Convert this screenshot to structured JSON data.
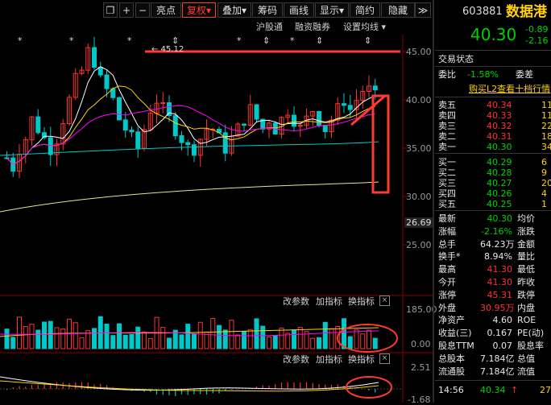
{
  "toolbar": {
    "icons": [
      "restore-icon",
      "plus-icon",
      "minus-icon"
    ],
    "buttons": [
      "亮点",
      "复权",
      "叠加",
      "筹码",
      "画线",
      "显示",
      "简约",
      "隐藏"
    ],
    "arrow_left": "◀",
    "arrow_right": "▶",
    "arrow_double": "≫"
  },
  "subbar": {
    "links": [
      "沪股通",
      "融资融券",
      "设置均线"
    ]
  },
  "kline": {
    "price_axis": [
      "45.00",
      "40.00",
      "35.00",
      "30.00",
      "25.00"
    ],
    "current_marker": "26.69",
    "high_label": "← 45.12",
    "star_marks": [
      "*",
      "*",
      "*",
      "*",
      "*",
      "*",
      "*",
      "*"
    ],
    "ma_colors": [
      "#ffffff",
      "#ffd200",
      "#ff00ff",
      "#00c8c8",
      "#e6e690"
    ],
    "up_color": "#ff3232",
    "down_color": "#00c8c8",
    "annotation_color": "#ff3b30"
  },
  "volume_panel": {
    "toolbar": [
      "改参数",
      "加指标",
      "换指标"
    ],
    "close": "×",
    "axis": [
      "185.00",
      "0.00"
    ]
  },
  "macd_panel": {
    "toolbar": [
      "改参数",
      "加指标",
      "换指标"
    ],
    "close": "×",
    "axis": [
      "2.51",
      "-1.68"
    ]
  },
  "quote": {
    "code": "603881",
    "name": "数据港",
    "price": "40.30",
    "change": "-0.89",
    "pct": "-2.16",
    "section_title": "交易状态",
    "weibi_label": "委比",
    "weibi_value": "-1.58%",
    "weicha_label": "委差",
    "l2_link": "购买L2查看十档行情",
    "asks": [
      {
        "label": "卖五",
        "price": "40.34",
        "vol": "11"
      },
      {
        "label": "卖四",
        "price": "40.33",
        "vol": "11"
      },
      {
        "label": "卖三",
        "price": "40.32",
        "vol": "22"
      },
      {
        "label": "卖二",
        "price": "40.31",
        "vol": "18"
      },
      {
        "label": "卖一",
        "price": "40.30",
        "vol": "34"
      }
    ],
    "bids": [
      {
        "label": "买一",
        "price": "40.29",
        "vol": "6"
      },
      {
        "label": "买二",
        "price": "40.28",
        "vol": "9"
      },
      {
        "label": "买三",
        "price": "40.27",
        "vol": "20"
      },
      {
        "label": "买四",
        "price": "40.26",
        "vol": "4"
      },
      {
        "label": "买五",
        "price": "40.25",
        "vol": "1"
      }
    ],
    "stats": [
      {
        "l": "最新",
        "v": "40.30",
        "vc": "grn",
        "l2": "均价"
      },
      {
        "l": "涨幅",
        "v": "-2.16%",
        "vc": "grn",
        "l2": "涨跌"
      },
      {
        "l": "总手",
        "v": "64.23万",
        "vc": "wht",
        "l2": "金额"
      },
      {
        "l": "换手*",
        "v": "8.94%",
        "vc": "wht",
        "l2": "量比"
      },
      {
        "l": "最高",
        "v": "41.30",
        "vc": "red",
        "l2": "最低"
      },
      {
        "l": "今开",
        "v": "41.30",
        "vc": "red",
        "l2": "昨收"
      },
      {
        "l": "涨停",
        "v": "45.31",
        "vc": "red",
        "l2": "跌停"
      },
      {
        "l": "外盘",
        "v": "30.95万",
        "vc": "red",
        "l2": "内盘"
      },
      {
        "l": "净资产",
        "v": "4.60",
        "vc": "wht",
        "l2": "ROE"
      },
      {
        "l": "收益(三)",
        "v": "0.167",
        "vc": "wht",
        "l2": "PE(动)"
      },
      {
        "l": "股息TTM",
        "v": "0.07",
        "vc": "wht",
        "l2": "股息率"
      },
      {
        "l": "总股本",
        "v": "7.184亿",
        "vc": "wht",
        "l2": "总值"
      },
      {
        "l": "流通股",
        "v": "7.184亿",
        "vc": "wht",
        "l2": "流值"
      }
    ],
    "tick": {
      "time": "14:56",
      "price": "40.34",
      "arrow": "↑",
      "vol": "27"
    }
  }
}
